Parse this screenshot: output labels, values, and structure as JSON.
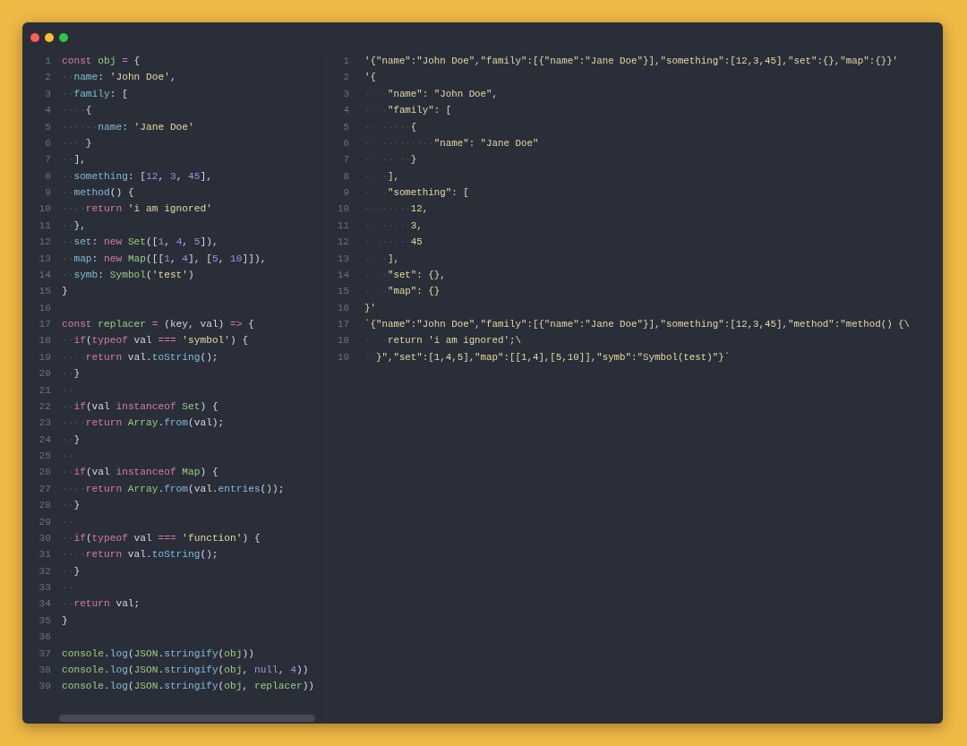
{
  "editor": {
    "left_pane": {
      "lines": [
        {
          "number": "1",
          "tokens": [
            {
              "text": "const ",
              "kind": "kw"
            },
            {
              "text": "obj",
              "kind": "id"
            },
            {
              "text": " = ",
              "kind": "kw"
            },
            {
              "text": "{",
              "kind": "p"
            }
          ]
        },
        {
          "number": "2",
          "indent": "··",
          "tokens": [
            {
              "text": "name",
              "kind": "prop"
            },
            {
              "text": ": ",
              "kind": "p"
            },
            {
              "text": "'John Doe'",
              "kind": "str"
            },
            {
              "text": ",",
              "kind": "p"
            }
          ]
        },
        {
          "number": "3",
          "indent": "··",
          "tokens": [
            {
              "text": "family",
              "kind": "prop"
            },
            {
              "text": ": [",
              "kind": "p"
            }
          ]
        },
        {
          "number": "4",
          "indent": "····",
          "tokens": [
            {
              "text": "{",
              "kind": "p"
            }
          ]
        },
        {
          "number": "5",
          "indent": "······",
          "tokens": [
            {
              "text": "name",
              "kind": "prop"
            },
            {
              "text": ": ",
              "kind": "p"
            },
            {
              "text": "'Jane Doe'",
              "kind": "str"
            }
          ]
        },
        {
          "number": "6",
          "indent": "····",
          "tokens": [
            {
              "text": "}",
              "kind": "p"
            }
          ]
        },
        {
          "number": "7",
          "indent": "··",
          "tokens": [
            {
              "text": "],",
              "kind": "p"
            }
          ]
        },
        {
          "number": "8",
          "indent": "··",
          "tokens": [
            {
              "text": "something",
              "kind": "prop"
            },
            {
              "text": ": [",
              "kind": "p"
            },
            {
              "text": "12",
              "kind": "num"
            },
            {
              "text": ", ",
              "kind": "p"
            },
            {
              "text": "3",
              "kind": "num"
            },
            {
              "text": ", ",
              "kind": "p"
            },
            {
              "text": "45",
              "kind": "num"
            },
            {
              "text": "],",
              "kind": "p"
            }
          ]
        },
        {
          "number": "9",
          "indent": "··",
          "tokens": [
            {
              "text": "method",
              "kind": "prop"
            },
            {
              "text": "() {",
              "kind": "p"
            }
          ]
        },
        {
          "number": "10",
          "indent": "····",
          "tokens": [
            {
              "text": "return ",
              "kind": "kw"
            },
            {
              "text": "'i am ignored'",
              "kind": "str"
            }
          ]
        },
        {
          "number": "11",
          "indent": "··",
          "tokens": [
            {
              "text": "},",
              "kind": "p"
            }
          ]
        },
        {
          "number": "12",
          "indent": "··",
          "tokens": [
            {
              "text": "set",
              "kind": "prop"
            },
            {
              "text": ": ",
              "kind": "p"
            },
            {
              "text": "new ",
              "kind": "kw"
            },
            {
              "text": "Set",
              "kind": "id"
            },
            {
              "text": "([",
              "kind": "p"
            },
            {
              "text": "1",
              "kind": "num"
            },
            {
              "text": ", ",
              "kind": "p"
            },
            {
              "text": "4",
              "kind": "num"
            },
            {
              "text": ", ",
              "kind": "p"
            },
            {
              "text": "5",
              "kind": "num"
            },
            {
              "text": "]),",
              "kind": "p"
            }
          ]
        },
        {
          "number": "13",
          "indent": "··",
          "tokens": [
            {
              "text": "map",
              "kind": "prop"
            },
            {
              "text": ": ",
              "kind": "p"
            },
            {
              "text": "new ",
              "kind": "kw"
            },
            {
              "text": "Map",
              "kind": "id"
            },
            {
              "text": "([[",
              "kind": "p"
            },
            {
              "text": "1",
              "kind": "num"
            },
            {
              "text": ", ",
              "kind": "p"
            },
            {
              "text": "4",
              "kind": "num"
            },
            {
              "text": "], [",
              "kind": "p"
            },
            {
              "text": "5",
              "kind": "num"
            },
            {
              "text": ", ",
              "kind": "p"
            },
            {
              "text": "10",
              "kind": "num"
            },
            {
              "text": "]]),",
              "kind": "p"
            }
          ]
        },
        {
          "number": "14",
          "indent": "··",
          "tokens": [
            {
              "text": "symb",
              "kind": "prop"
            },
            {
              "text": ": ",
              "kind": "p"
            },
            {
              "text": "Symbol",
              "kind": "id"
            },
            {
              "text": "(",
              "kind": "p"
            },
            {
              "text": "'test'",
              "kind": "str"
            },
            {
              "text": ")",
              "kind": "p"
            }
          ]
        },
        {
          "number": "15",
          "tokens": [
            {
              "text": "}",
              "kind": "p"
            }
          ]
        },
        {
          "number": "16"
        },
        {
          "number": "17",
          "tokens": [
            {
              "text": "const ",
              "kind": "kw"
            },
            {
              "text": "replacer",
              "kind": "id"
            },
            {
              "text": " = ",
              "kind": "kw"
            },
            {
              "text": "(key, val) ",
              "kind": "p"
            },
            {
              "text": "=>",
              "kind": "kw"
            },
            {
              "text": " {",
              "kind": "p"
            }
          ]
        },
        {
          "number": "18",
          "indent": "··",
          "tokens": [
            {
              "text": "if",
              "kind": "kw"
            },
            {
              "text": "(",
              "kind": "p"
            },
            {
              "text": "typeof ",
              "kind": "kw"
            },
            {
              "text": "val ",
              "kind": "p"
            },
            {
              "text": "=== ",
              "kind": "kw"
            },
            {
              "text": "'symbol'",
              "kind": "str"
            },
            {
              "text": ") {",
              "kind": "p"
            }
          ]
        },
        {
          "number": "19",
          "indent": "····",
          "tokens": [
            {
              "text": "return ",
              "kind": "kw"
            },
            {
              "text": "val.",
              "kind": "p"
            },
            {
              "text": "toString",
              "kind": "prop"
            },
            {
              "text": "();",
              "kind": "p"
            }
          ]
        },
        {
          "number": "20",
          "indent": "··",
          "tokens": [
            {
              "text": "}",
              "kind": "p"
            }
          ]
        },
        {
          "number": "21",
          "indent": "··"
        },
        {
          "number": "22",
          "indent": "··",
          "tokens": [
            {
              "text": "if",
              "kind": "kw"
            },
            {
              "text": "(val ",
              "kind": "p"
            },
            {
              "text": "instanceof ",
              "kind": "kw"
            },
            {
              "text": "Set",
              "kind": "id"
            },
            {
              "text": ") {",
              "kind": "p"
            }
          ]
        },
        {
          "number": "23",
          "indent": "····",
          "tokens": [
            {
              "text": "return ",
              "kind": "kw"
            },
            {
              "text": "Array",
              "kind": "id"
            },
            {
              "text": ".",
              "kind": "p"
            },
            {
              "text": "from",
              "kind": "prop"
            },
            {
              "text": "(val);",
              "kind": "p"
            }
          ]
        },
        {
          "number": "24",
          "indent": "··",
          "tokens": [
            {
              "text": "}",
              "kind": "p"
            }
          ]
        },
        {
          "number": "25",
          "indent": "··"
        },
        {
          "number": "26",
          "indent": "··",
          "tokens": [
            {
              "text": "if",
              "kind": "kw"
            },
            {
              "text": "(val ",
              "kind": "p"
            },
            {
              "text": "instanceof ",
              "kind": "kw"
            },
            {
              "text": "Map",
              "kind": "id"
            },
            {
              "text": ") {",
              "kind": "p"
            }
          ]
        },
        {
          "number": "27",
          "indent": "····",
          "tokens": [
            {
              "text": "return ",
              "kind": "kw"
            },
            {
              "text": "Array",
              "kind": "id"
            },
            {
              "text": ".",
              "kind": "p"
            },
            {
              "text": "from",
              "kind": "prop"
            },
            {
              "text": "(val.",
              "kind": "p"
            },
            {
              "text": "entries",
              "kind": "prop"
            },
            {
              "text": "());",
              "kind": "p"
            }
          ]
        },
        {
          "number": "28",
          "indent": "··",
          "tokens": [
            {
              "text": "}",
              "kind": "p"
            }
          ]
        },
        {
          "number": "29",
          "indent": "··"
        },
        {
          "number": "30",
          "indent": "··",
          "tokens": [
            {
              "text": "if",
              "kind": "kw"
            },
            {
              "text": "(",
              "kind": "p"
            },
            {
              "text": "typeof ",
              "kind": "kw"
            },
            {
              "text": "val ",
              "kind": "p"
            },
            {
              "text": "=== ",
              "kind": "kw"
            },
            {
              "text": "'function'",
              "kind": "str"
            },
            {
              "text": ") {",
              "kind": "p"
            }
          ]
        },
        {
          "number": "31",
          "indent": "····",
          "tokens": [
            {
              "text": "return ",
              "kind": "kw"
            },
            {
              "text": "val.",
              "kind": "p"
            },
            {
              "text": "toString",
              "kind": "prop"
            },
            {
              "text": "();",
              "kind": "p"
            }
          ]
        },
        {
          "number": "32",
          "indent": "··",
          "tokens": [
            {
              "text": "}",
              "kind": "p"
            }
          ]
        },
        {
          "number": "33",
          "indent": "··"
        },
        {
          "number": "34",
          "indent": "··",
          "tokens": [
            {
              "text": "return ",
              "kind": "kw"
            },
            {
              "text": "val;",
              "kind": "p"
            }
          ]
        },
        {
          "number": "35",
          "tokens": [
            {
              "text": "}",
              "kind": "p"
            }
          ]
        },
        {
          "number": "36"
        },
        {
          "number": "37",
          "tokens": [
            {
              "text": "console",
              "kind": "id"
            },
            {
              "text": ".",
              "kind": "p"
            },
            {
              "text": "log",
              "kind": "prop"
            },
            {
              "text": "(",
              "kind": "p"
            },
            {
              "text": "JSON",
              "kind": "id"
            },
            {
              "text": ".",
              "kind": "p"
            },
            {
              "text": "stringify",
              "kind": "prop"
            },
            {
              "text": "(",
              "kind": "p"
            },
            {
              "text": "obj",
              "kind": "id"
            },
            {
              "text": "))",
              "kind": "p"
            }
          ]
        },
        {
          "number": "38",
          "tokens": [
            {
              "text": "console",
              "kind": "id"
            },
            {
              "text": ".",
              "kind": "p"
            },
            {
              "text": "log",
              "kind": "prop"
            },
            {
              "text": "(",
              "kind": "p"
            },
            {
              "text": "JSON",
              "kind": "id"
            },
            {
              "text": ".",
              "kind": "p"
            },
            {
              "text": "stringify",
              "kind": "prop"
            },
            {
              "text": "(",
              "kind": "p"
            },
            {
              "text": "obj",
              "kind": "id"
            },
            {
              "text": ", ",
              "kind": "p"
            },
            {
              "text": "null",
              "kind": "num"
            },
            {
              "text": ", ",
              "kind": "p"
            },
            {
              "text": "4",
              "kind": "num"
            },
            {
              "text": "))",
              "kind": "p"
            }
          ]
        },
        {
          "number": "39",
          "tokens": [
            {
              "text": "console",
              "kind": "id"
            },
            {
              "text": ".",
              "kind": "p"
            },
            {
              "text": "log",
              "kind": "prop"
            },
            {
              "text": "(",
              "kind": "p"
            },
            {
              "text": "JSON",
              "kind": "id"
            },
            {
              "text": ".",
              "kind": "p"
            },
            {
              "text": "stringify",
              "kind": "prop"
            },
            {
              "text": "(",
              "kind": "p"
            },
            {
              "text": "obj",
              "kind": "id"
            },
            {
              "text": ", ",
              "kind": "p"
            },
            {
              "text": "replacer",
              "kind": "id"
            },
            {
              "text": "))",
              "kind": "p"
            }
          ]
        }
      ]
    },
    "right_pane": {
      "lines": [
        {
          "number": "1",
          "text": "'{\"name\":\"John Doe\",\"family\":[{\"name\":\"Jane Doe\"}],\"something\":[12,3,45],\"set\":{},\"map\":{}}'"
        },
        {
          "number": "2",
          "text": "'{"
        },
        {
          "number": "3",
          "indent": "····",
          "text": "\"name\": \"John Doe\","
        },
        {
          "number": "4",
          "indent": "····",
          "text": "\"family\": ["
        },
        {
          "number": "5",
          "indent": "········",
          "text": "{"
        },
        {
          "number": "6",
          "indent": "············",
          "text": "\"name\": \"Jane Doe\""
        },
        {
          "number": "7",
          "indent": "········",
          "text": "}"
        },
        {
          "number": "8",
          "indent": "····",
          "text": "],"
        },
        {
          "number": "9",
          "indent": "····",
          "text": "\"something\": ["
        },
        {
          "number": "10",
          "indent": "········",
          "text": "12,"
        },
        {
          "number": "11",
          "indent": "········",
          "text": "3,"
        },
        {
          "number": "12",
          "indent": "········",
          "text": "45"
        },
        {
          "number": "13",
          "indent": "····",
          "text": "],"
        },
        {
          "number": "14",
          "indent": "····",
          "text": "\"set\": {},"
        },
        {
          "number": "15",
          "indent": "····",
          "text": "\"map\": {}"
        },
        {
          "number": "16",
          "text": "}'"
        },
        {
          "number": "17",
          "text": "`{\"name\":\"John Doe\",\"family\":[{\"name\":\"Jane Doe\"}],\"something\":[12,3,45],\"method\":\"method() {\\"
        },
        {
          "number": "18",
          "indent": "····",
          "text": "return 'i am ignored';\\"
        },
        {
          "number": "19",
          "indent": "··",
          "text": "}\",\"set\":[1,4,5],\"map\":[[1,4],[5,10]],\"symb\":\"Symbol(test)\"}`"
        }
      ]
    }
  }
}
